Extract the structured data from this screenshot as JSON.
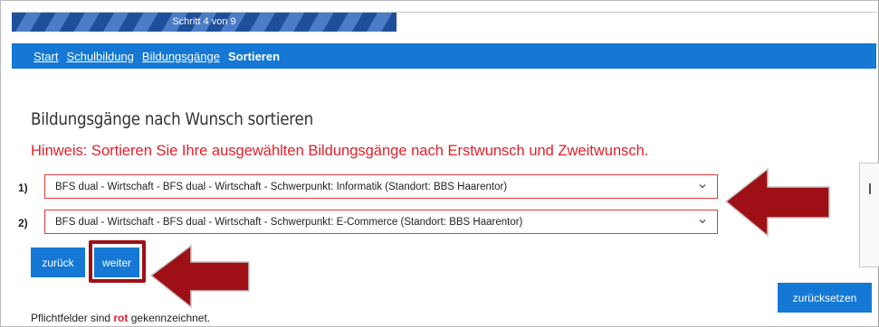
{
  "progress": {
    "label": "Schritt 4 von 9",
    "fraction": 0.444
  },
  "nav": {
    "start": "Start",
    "schulbildung": "Schulbildung",
    "bildungsgaenge": "Bildungsgänge",
    "current": "Sortieren"
  },
  "page": {
    "title": "Bildungsgänge nach Wunsch sortieren",
    "hint": "Hinweis: Sortieren Sie Ihre ausgewählten Bildungsgänge nach Erstwunsch und Zweitwunsch."
  },
  "choices": [
    {
      "num": "1)",
      "value": "BFS dual - Wirtschaft - BFS dual - Wirtschaft - Schwerpunkt: Informatik (Standort: BBS Haarentor)"
    },
    {
      "num": "2)",
      "value": "BFS dual - Wirtschaft - BFS dual - Wirtschaft - Schwerpunkt: E-Commerce (Standort: BBS Haarentor)"
    }
  ],
  "buttons": {
    "back": "zurück",
    "next": "weiter",
    "reset": "zurücksetzen"
  },
  "footnote": {
    "before": "Pflichtfelder sind",
    "red_word": "rot",
    "after": "gekennzeichnet."
  },
  "colors": {
    "nav_blue": "#1478d4",
    "hint_red": "#e4202b",
    "arrow_red": "#9e1015"
  },
  "icons": {
    "select_chevron": "chevron-down-icon",
    "annotation_arrow": "arrow-left-icon"
  }
}
